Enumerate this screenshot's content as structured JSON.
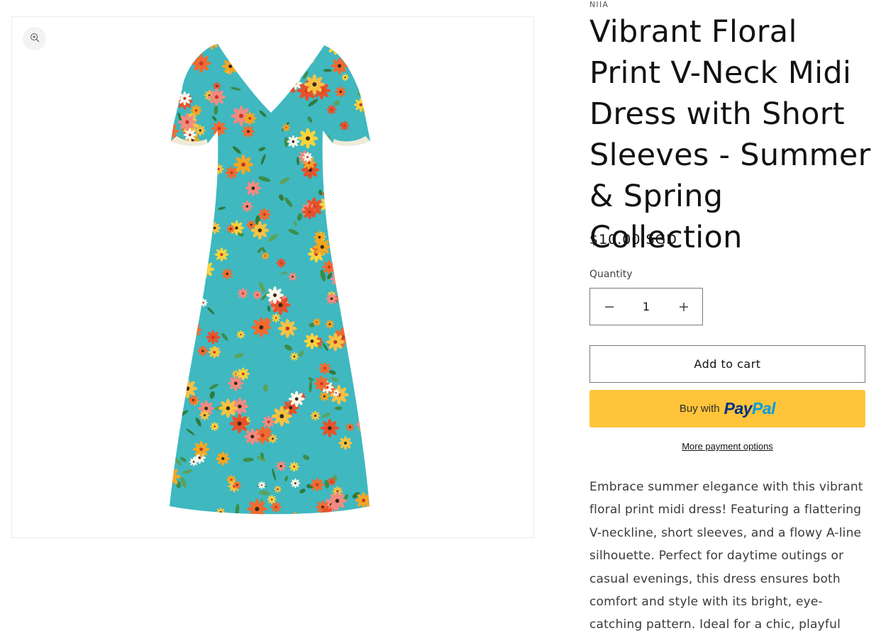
{
  "product": {
    "vendor": "NIIA",
    "title": "Vibrant Floral Print V-Neck Midi Dress with Short Sleeves - Summer & Spring Collection",
    "price": "$10.00 SGD",
    "image_alt": "Floral print V-neck midi dress on turquoise background"
  },
  "media": {
    "zoom_icon": "zoom-in-icon"
  },
  "quantity": {
    "label": "Quantity",
    "value": "1",
    "decrease_icon": "minus-icon",
    "increase_icon": "plus-icon"
  },
  "actions": {
    "add_to_cart": "Add to cart",
    "paypal_prefix": "Buy with",
    "paypal_logo_pay": "Pay",
    "paypal_logo_pal": "Pal",
    "more_payment": "More payment options"
  },
  "description": "Embrace summer elegance with this vibrant floral print midi dress! Featuring a flattering V-neckline, short sleeves, and a flowy A-line silhouette. Perfect for daytime outings or casual evenings, this dress ensures both comfort and style with its bright, eye-catching pattern. Ideal for a chic, playful wardrobe update.",
  "colors": {
    "paypal_yellow": "#ffc439",
    "paypal_dark_blue": "#003087",
    "paypal_light_blue": "#009cde",
    "dress_background": "#3fb8c0"
  }
}
